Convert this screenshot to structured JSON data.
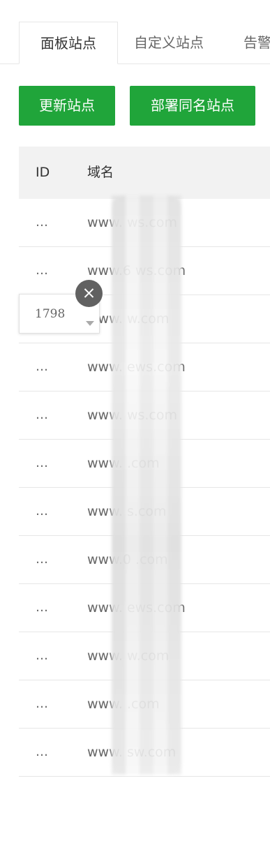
{
  "tabs": [
    {
      "label": "面板站点"
    },
    {
      "label": "自定义站点"
    },
    {
      "label": "告警"
    }
  ],
  "buttons": {
    "update": "更新站点",
    "deploy": "部署同名站点"
  },
  "table": {
    "headers": {
      "id": "ID",
      "domain": "域名"
    },
    "rows": [
      {
        "id": "…",
        "domain": "www.        ws.com"
      },
      {
        "id": "…",
        "domain": "www.6       ws.com"
      },
      {
        "id": "…",
        "domain": "www.        w.com"
      },
      {
        "id": "…",
        "domain": "www.        ews.com"
      },
      {
        "id": "…",
        "domain": "www.        ws.com"
      },
      {
        "id": "…",
        "domain": "www.        .com"
      },
      {
        "id": "…",
        "domain": "www.        s.com"
      },
      {
        "id": "…",
        "domain": "www.0       .com"
      },
      {
        "id": "…",
        "domain": "www.        ews.com"
      },
      {
        "id": "…",
        "domain": "www.        w.com"
      },
      {
        "id": "…",
        "domain": "www.        .com"
      },
      {
        "id": "…",
        "domain": "www.        sw.com"
      }
    ]
  },
  "popup": {
    "value": "1798"
  }
}
